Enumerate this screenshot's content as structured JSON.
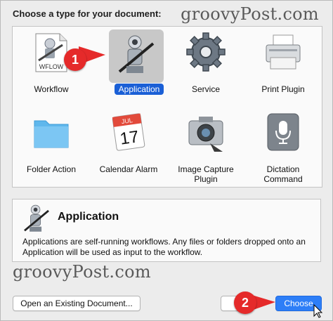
{
  "prompt": "Choose a type for your document:",
  "watermark_top": "groovyPost.com",
  "watermark_bottom": "groovyPost.com",
  "types": [
    {
      "label": "Workflow",
      "icon": "workflow-document-icon",
      "badge": "WFLOW"
    },
    {
      "label": "Application",
      "icon": "automator-robot-icon",
      "selected": true
    },
    {
      "label": "Service",
      "icon": "gear-icon"
    },
    {
      "label": "Print Plugin",
      "icon": "printer-icon"
    },
    {
      "label": "Folder Action",
      "icon": "folder-icon"
    },
    {
      "label": "Calendar Alarm",
      "icon": "calendar-icon",
      "month": "JUL",
      "day": "17"
    },
    {
      "label": "Image Capture Plugin",
      "label_lines": [
        "Image Capture",
        "Plugin"
      ],
      "icon": "camera-icon"
    },
    {
      "label": "Dictation Command",
      "label_lines": [
        "Dictation",
        "Command"
      ],
      "icon": "microphone-icon"
    }
  ],
  "callouts": [
    "1",
    "2"
  ],
  "description": {
    "title": "Application",
    "text": "Applications are self-running workflows. Any files or folders dropped onto an Application will be used as input to the workflow."
  },
  "buttons": {
    "open_existing": "Open an Existing Document...",
    "choose": "Choose"
  },
  "colors": {
    "accent": "#1a5fd6",
    "callout": "#e52a2a"
  }
}
